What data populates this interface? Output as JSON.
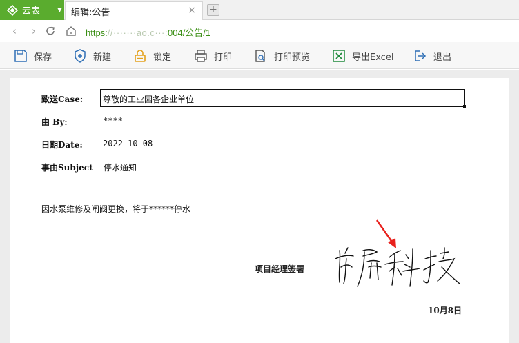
{
  "app": {
    "name": "云表"
  },
  "tabs": [
    {
      "title": "编辑:公告",
      "active": true
    }
  ],
  "address": {
    "prefix": "https:",
    "obscured": "//·······ao.c···:",
    "suffix": "004/公告/1"
  },
  "toolbar": {
    "save": "保存",
    "new": "新建",
    "lock": "锁定",
    "print": "打印",
    "print_preview": "打印预览",
    "export_excel": "导出Excel",
    "exit": "退出"
  },
  "form": {
    "case_label": "致送Case:",
    "case_value": "尊敬的工业园各企业单位",
    "by_label": "由 By:",
    "by_value": "****",
    "date_label": "日期Date:",
    "date_value": "2022-10-08",
    "subject_label": "事由Subject",
    "subject_value": "停水通知",
    "body": "因水泵维修及闸阀更换，将于******停水",
    "signature_label": "项目经理签署",
    "signature_text": "南屏科技",
    "sign_date": "10月8日"
  },
  "colors": {
    "brand": "#5aac2e",
    "url": "#3b8f15",
    "annotation_arrow": "#e8211d"
  }
}
